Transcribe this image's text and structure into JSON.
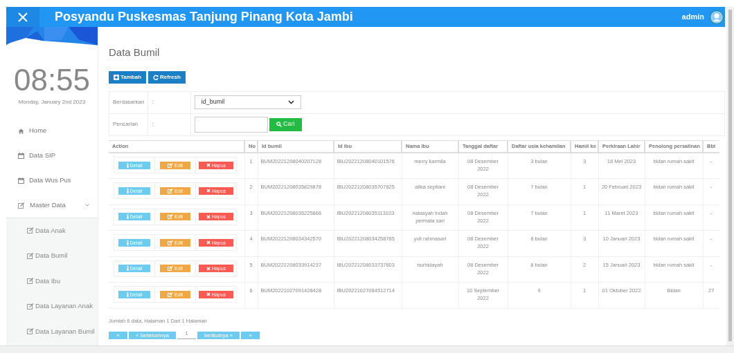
{
  "header": {
    "title": "Posyandu Puskesmas Tanjung Pinang Kota Jambi",
    "user": "admin"
  },
  "sidebar": {
    "clock": "08:55",
    "date": "Monday, January 2nd 2023",
    "items": [
      {
        "label": "Home"
      },
      {
        "label": "Data SIP"
      },
      {
        "label": "Data Wus Pus"
      },
      {
        "label": "Master Data",
        "expanded": true,
        "children": [
          {
            "label": "Data Anak"
          },
          {
            "label": "Data Bumil"
          },
          {
            "label": "Data Ibu"
          },
          {
            "label": "Data Layanan Anak"
          },
          {
            "label": "Data Layanan Bumil"
          }
        ]
      }
    ]
  },
  "page_title": "Data Bumil",
  "toolbar": [
    "Tambah",
    "Refresh"
  ],
  "filter": {
    "by_label": "Berdasarkan",
    "by_sep": ":",
    "by_value": "id_bumil",
    "search_label": "Pencarian",
    "search_sep": ":",
    "search_button": "Cari"
  },
  "table": {
    "action_column": "Action",
    "columns": [
      "No",
      "Id bumil",
      "Id ibu",
      "Nama Ibu",
      "Tanggal daftar",
      "Daftar usia kehamilan",
      "Hamil ke",
      "Perkiraan Lahir",
      "Penolong persalinan",
      "Bbl"
    ],
    "rows": [
      {
        "actions": [
          "Detail",
          "Edit",
          "Hapus"
        ],
        "cells": [
          "1",
          "BUM20221208040207128",
          "IBU20221208040101576",
          "merry karmila",
          "08 Desember 2022",
          "3 bulan",
          "3",
          "18 Mei 2023",
          "bidan rumah sakit",
          "-"
        ]
      },
      {
        "actions": [
          "Detail",
          "Edit",
          "Hapus"
        ],
        "cells": [
          "2",
          "BUM20221208035829878",
          "IBU20221208035707825",
          "atika septiani",
          "08 Desember 2022",
          "7 bulan",
          "1",
          "20 Februari 2023",
          "bidan rumah sakit",
          "-"
        ]
      },
      {
        "actions": [
          "Detail",
          "Edit",
          "Hapus"
        ],
        "cells": [
          "3",
          "BUM20221208035225866",
          "IBU20221208035113103",
          "natasyah indah permata sari",
          "08 Desember 2022",
          "7 bulan",
          "1",
          "11 Maret 2023",
          "bidan rumah sakit",
          "-"
        ]
      },
      {
        "actions": [
          "Detail",
          "Edit",
          "Hapus"
        ],
        "cells": [
          "4",
          "BUM20221208034342570",
          "IBU20221208034258785",
          "yuli rahmasari",
          "08 Desember 2022",
          "8 bulan",
          "3",
          "10 Januari 2023",
          "bidan rumah sakit",
          "-"
        ]
      },
      {
        "actions": [
          "Detail",
          "Edit",
          "Hapus"
        ],
        "cells": [
          "5",
          "BUM20221208033914237",
          "IBU20221208033737603",
          "nurhidayah",
          "08 Desember 2022",
          "8 bulan",
          "2",
          "15 Januari 2023",
          "bidan rumah sakit",
          "-"
        ]
      },
      {
        "actions": [
          "Detail",
          "Edit",
          "Hapus"
        ],
        "cells": [
          "6",
          "BUM20221027091428428",
          "IBU20221027084512714",
          "",
          "10 September 2022",
          "9",
          "1",
          "01 Oktober 2022",
          "Bidan",
          "27"
        ]
      }
    ]
  },
  "summary": "Jumlah 6 data, Halaman 1 Dari 1 Halaman",
  "pagination": {
    "first": "«",
    "prev": "« Sebelumnya",
    "page": "1",
    "next": "berikutnya »",
    "last": "»"
  }
}
